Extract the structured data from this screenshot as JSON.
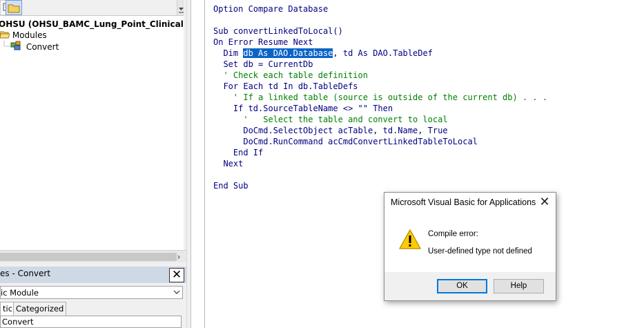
{
  "project_explorer": {
    "tree": {
      "root_label": "OHSU (OHSU_BAMC_Lung_Point_Clinical_Datab",
      "modules_label": "Modules",
      "module_item_label": "Convert"
    },
    "scroll_right_glyph": "›"
  },
  "properties": {
    "title": "es - Convert",
    "close_glyph": "✕",
    "object_select": "ic Module",
    "tabs": [
      "tic",
      "Categorized"
    ],
    "name_value": "Convert"
  },
  "code_lines": [
    {
      "text": "Option Compare Database",
      "kind": "code"
    },
    {
      "text": "",
      "kind": "code"
    },
    {
      "text": "Sub convertLinkedToLocal()",
      "kind": "code"
    },
    {
      "text": "On Error Resume Next",
      "kind": "code"
    },
    {
      "text": "  Dim ",
      "kind": "code"
    },
    {
      "text": "  Set db = CurrentDb",
      "kind": "code"
    },
    {
      "text": "  ' Check each table definition",
      "kind": "comment"
    },
    {
      "text": "  For Each td In db.TableDefs",
      "kind": "code"
    },
    {
      "text": "    ' If a linked table (source is outside of the current db) . . .",
      "kind": "comment"
    },
    {
      "text": "    If td.SourceTableName <> \"\" Then",
      "kind": "code"
    },
    {
      "text": "      '   Select the table and convert to local",
      "kind": "comment"
    },
    {
      "text": "      DoCmd.SelectObject acTable, td.Name, True",
      "kind": "code"
    },
    {
      "text": "      DoCmd.RunCommand acCmdConvertLinkedTableToLocal",
      "kind": "code"
    },
    {
      "text": "    End If",
      "kind": "code"
    },
    {
      "text": "  Next",
      "kind": "code"
    },
    {
      "text": "",
      "kind": "code"
    },
    {
      "text": "End Sub",
      "kind": "code"
    }
  ],
  "dim_line": {
    "prefix": "  Dim ",
    "selected": "db As DAO.Database",
    "suffix": ", td As DAO.TableDef"
  },
  "dialog": {
    "title": "Microsoft Visual Basic for Applications",
    "close_glyph": "✕",
    "message_heading": "Compile error:",
    "message_detail": "User-defined type not defined",
    "ok_label": "OK",
    "help_label": "Help",
    "icon": "warning-icon"
  },
  "colors": {
    "keyword": "#000080",
    "comment": "#008000",
    "selection": "#0a64c8",
    "dialog_default_border": "#0078d7"
  }
}
